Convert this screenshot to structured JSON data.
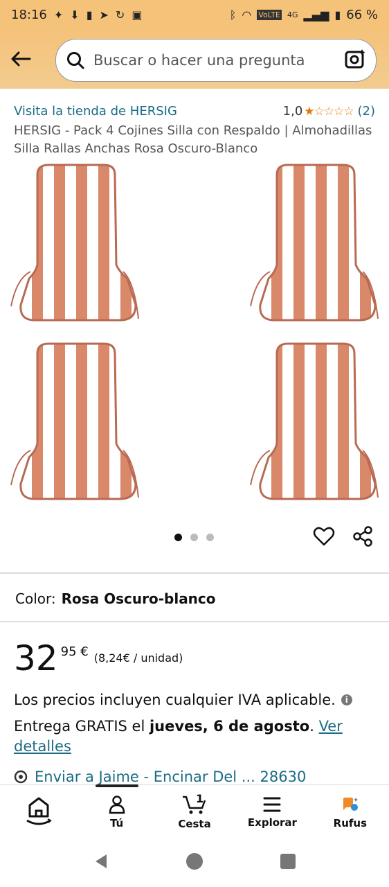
{
  "status": {
    "time": "18:16",
    "network": "4G",
    "volte": "VoLTE",
    "battery": "66 %"
  },
  "search": {
    "placeholder": "Buscar o hacer una pregunta"
  },
  "product": {
    "store_link": "Visita la tienda de HERSIG",
    "rating_value": "1,0",
    "rating_stars": 1,
    "rating_count": "(2)",
    "title": "HERSIG - Pack 4 Cojines Silla con Respaldo | Almohadillas Silla Rallas Anchas Rosa Oscuro-Blanco",
    "image_count": 3,
    "image_active": 1
  },
  "color": {
    "label": "Color:",
    "value": "Rosa Oscuro-blanco"
  },
  "price": {
    "whole": "32",
    "cents": "95 €",
    "unit": "(8,24€ / unidad)"
  },
  "iva": "Los precios incluyen cualquier IVA aplicable.",
  "delivery": {
    "prefix": "Entrega GRATIS el ",
    "date": "jueves, 6 de agosto",
    "suffix": ". ",
    "link": "Ver detalles"
  },
  "ship_to": "Enviar a Jaime - Encinar Del ... 28630",
  "nav": [
    {
      "label": "",
      "icon": "home-icon"
    },
    {
      "label": "Tú",
      "icon": "user-icon"
    },
    {
      "label": "Cesta",
      "icon": "cart-icon",
      "count": "1"
    },
    {
      "label": "Explorar",
      "icon": "menu-icon"
    },
    {
      "label": "Rufus",
      "icon": "rufus-icon"
    }
  ],
  "colors": {
    "accent": "#f5c27a",
    "link": "#1a6b86",
    "stripe": "#d9886a",
    "star": "#e47911"
  }
}
